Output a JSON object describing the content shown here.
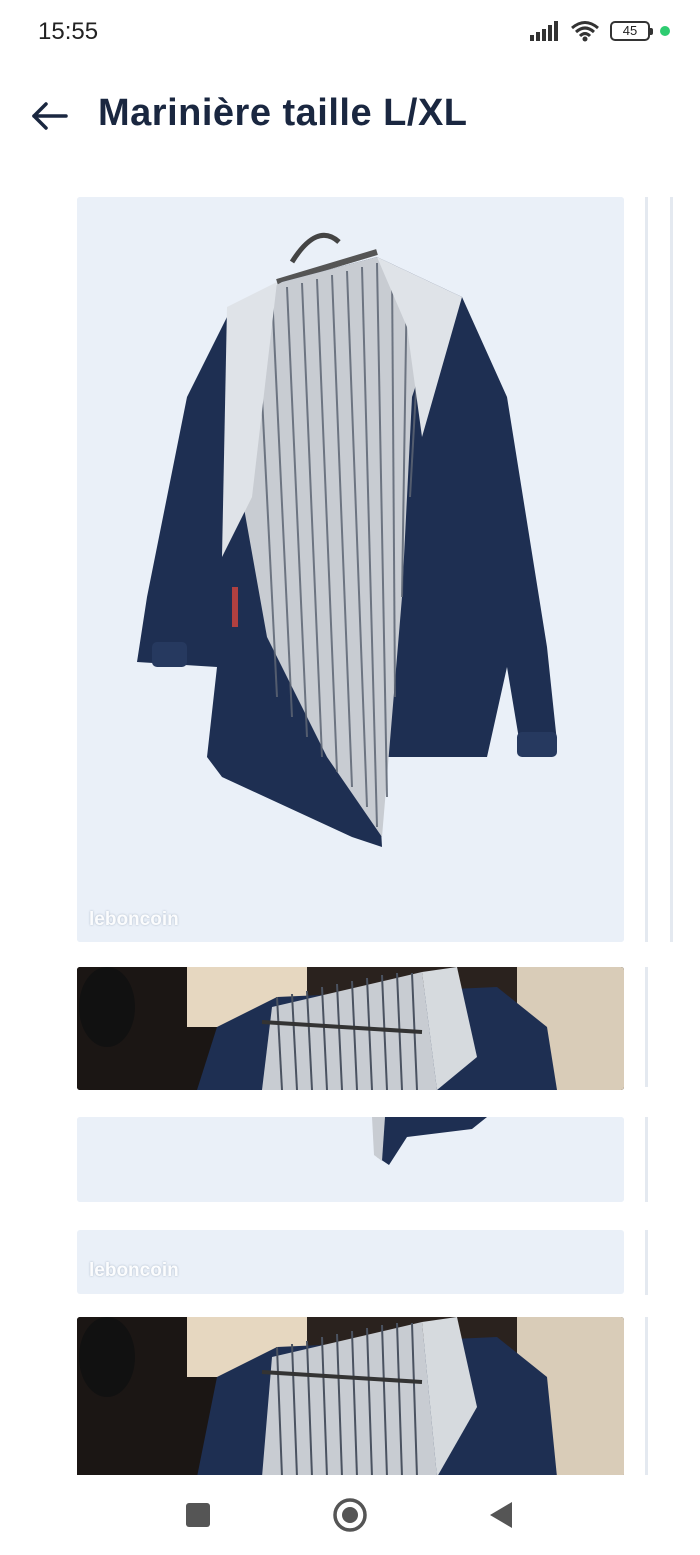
{
  "status_bar": {
    "time": "15:55",
    "battery_level": "45"
  },
  "header": {
    "title": "Marinière taille L/XL"
  },
  "gallery": {
    "watermark": "leboncoin"
  },
  "colors": {
    "title": "#1a2740",
    "photo_background": "#eaf0f8",
    "jacket_navy": "#1e2f52",
    "battery_dot": "#2ecc71"
  },
  "icons": {
    "back": "arrow-left-icon",
    "signal": "signal-icon",
    "wifi": "wifi-icon",
    "battery": "battery-icon",
    "nav_recents": "square-icon",
    "nav_home": "circle-icon",
    "nav_back": "triangle-back-icon"
  }
}
